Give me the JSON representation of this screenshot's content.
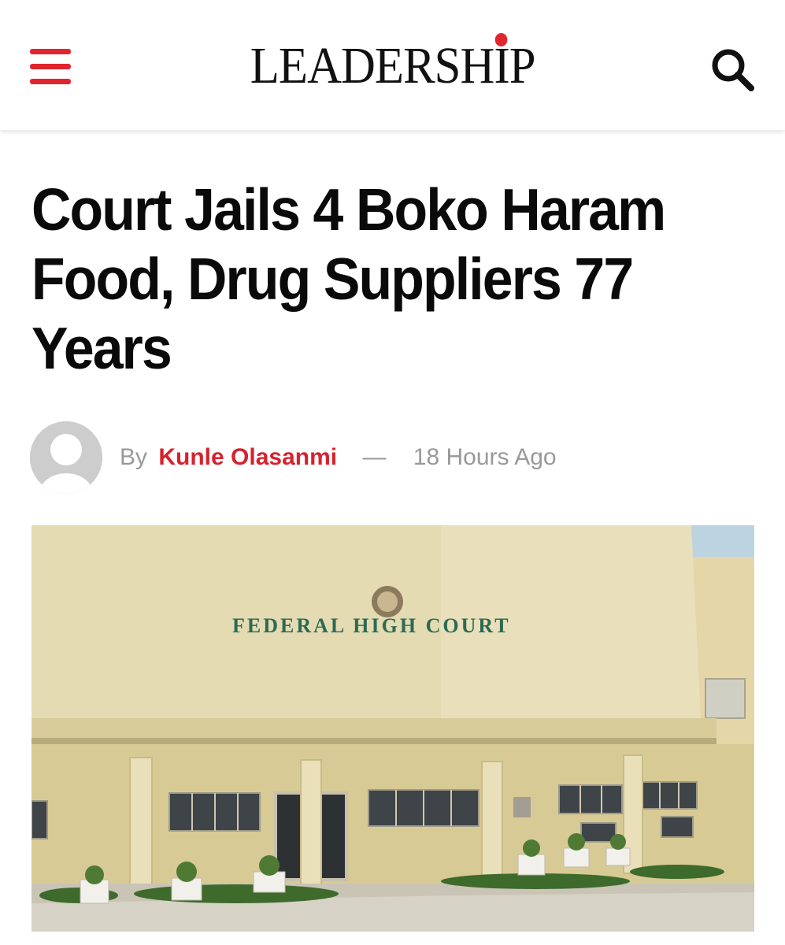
{
  "header": {
    "logo_text": "LEADERSHIP",
    "menu_icon": "hamburger-menu-icon",
    "search_icon": "search-icon",
    "accent_color": "#e0252f"
  },
  "article": {
    "headline_lines": [
      "Court Jails 4 Boko Haram",
      "Food, Drug Suppliers 77",
      "Years"
    ],
    "byline": {
      "prefix": "By",
      "author": "Kunle Olasanmi",
      "separator": "—",
      "time": "18 Hours Ago"
    },
    "hero_image": {
      "signage": "FEDERAL HIGH COURT"
    }
  }
}
